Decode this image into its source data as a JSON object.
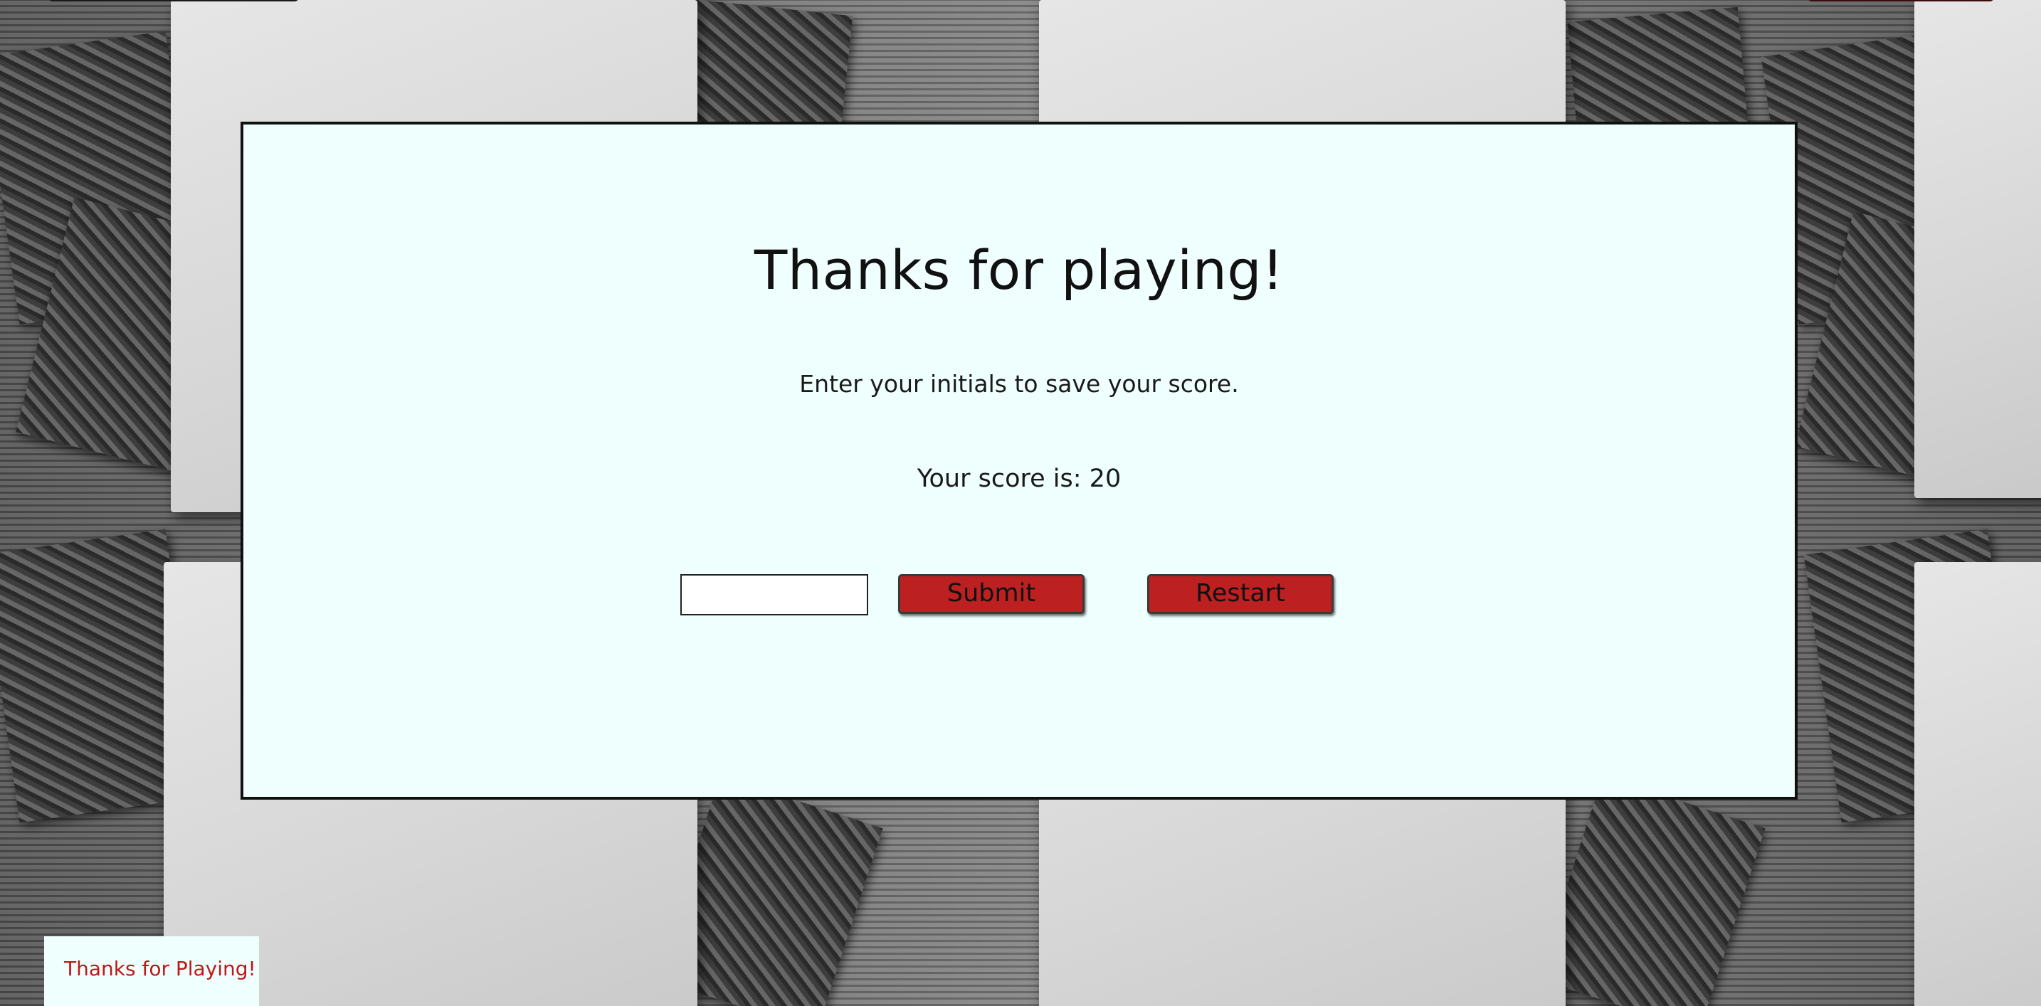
{
  "modal": {
    "title": "Thanks for playing!",
    "instruction": "Enter your initials to save your score.",
    "score_label": "Your score is: ",
    "score_value": "20",
    "initials_input": {
      "value": "",
      "placeholder": ""
    },
    "submit_label": "Submit",
    "restart_label": "Restart"
  },
  "toast": {
    "message": "Thanks for Playing!"
  },
  "colors": {
    "modal_background": "#effffe",
    "button_red": "#bd2020",
    "toast_text": "#c01818"
  }
}
